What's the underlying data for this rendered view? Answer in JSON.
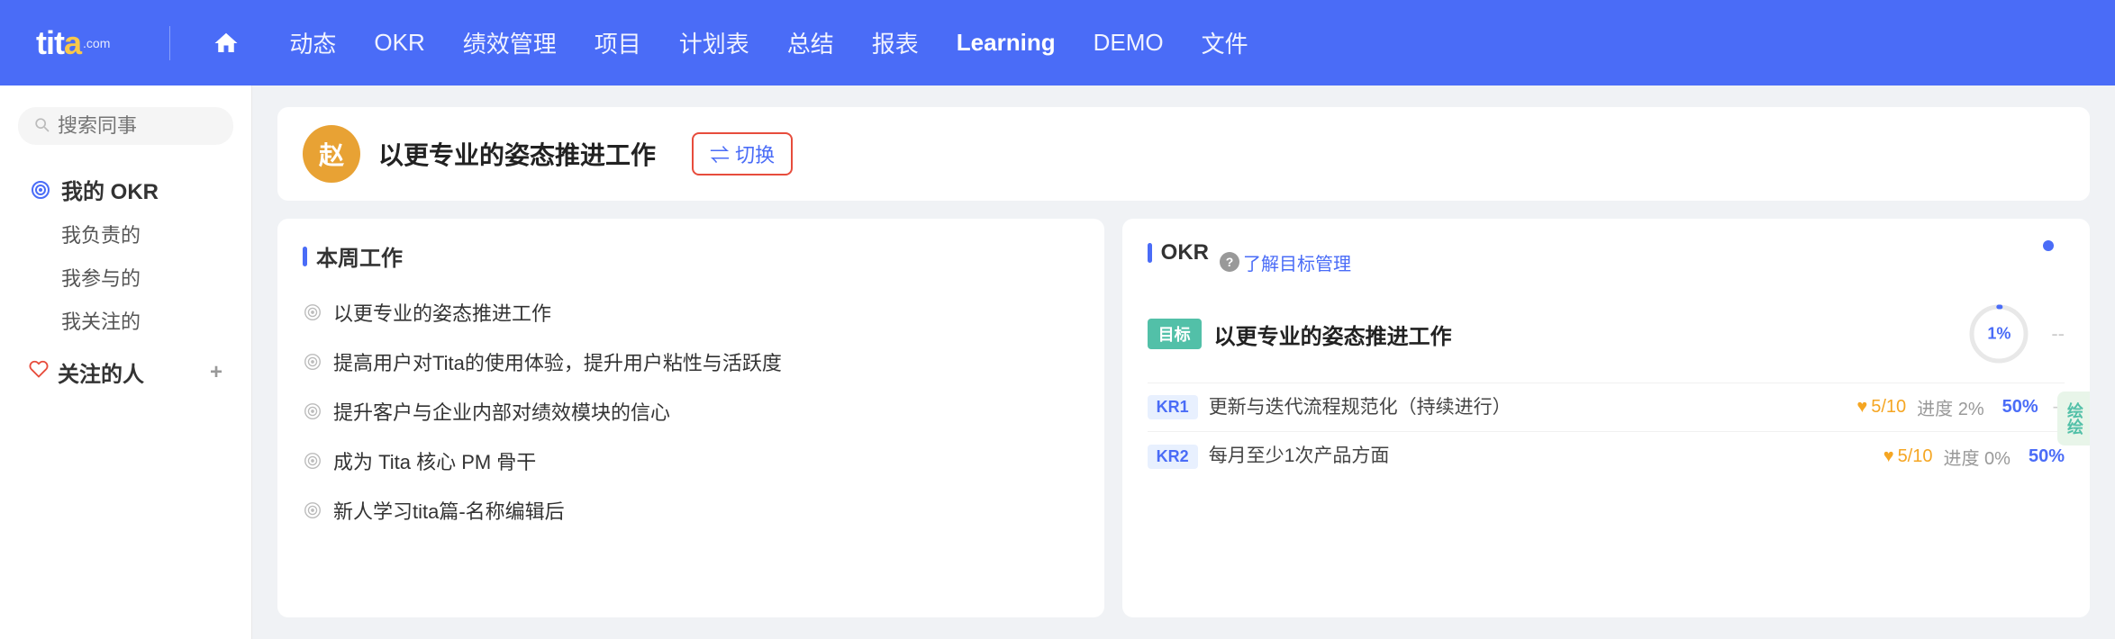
{
  "brand": {
    "name_part1": "tit",
    "name_o": "a",
    "name_com": ".com",
    "logo_display": "tita",
    "logo_suffix": ".com"
  },
  "header": {
    "nav_items": [
      {
        "label": "动态",
        "id": "dongtai"
      },
      {
        "label": "OKR",
        "id": "okr"
      },
      {
        "label": "绩效管理",
        "id": "jixiao"
      },
      {
        "label": "项目",
        "id": "xiangmu"
      },
      {
        "label": "计划表",
        "id": "jihuabiao"
      },
      {
        "label": "总结",
        "id": "zongjie"
      },
      {
        "label": "报表",
        "id": "baobiao"
      },
      {
        "label": "Learning",
        "id": "learning"
      },
      {
        "label": "DEMO",
        "id": "demo"
      },
      {
        "label": "文件",
        "id": "wenjian"
      }
    ]
  },
  "sidebar": {
    "search_placeholder": "搜索同事",
    "my_okr_label": "我的 OKR",
    "sub_items": [
      "我负责的",
      "我参与的",
      "我关注的"
    ],
    "follow_label": "关注的人",
    "plus_label": "+"
  },
  "user_section": {
    "avatar_char": "赵",
    "title": "以更专业的姿态推进工作",
    "switch_label": "⇌ 切换"
  },
  "work_section": {
    "title": "本周工作",
    "items": [
      "以更专业的姿态推进工作",
      "提高用户对Tita的使用体验，提升用户粘性与活跃度",
      "提升客户与企业内部对绩效模块的信心",
      "成为 Tita 核心 PM 骨干",
      "新人学习tita篇-名称编辑后"
    ]
  },
  "okr_section": {
    "title": "OKR",
    "help_text": "了解目标管理",
    "goal": {
      "tag": "目标",
      "text": "以更专业的姿态推进工作",
      "percent": "1%",
      "dash": "--"
    },
    "krs": [
      {
        "badge": "KR1",
        "text": "更新与迭代流程规范化（持续进行）",
        "score": "5/10",
        "progress_label": "进度 2%",
        "progress_pct": "50%",
        "dash": "--"
      },
      {
        "badge": "KR2",
        "text": "每月至少1次产品方面",
        "score": "5/10",
        "progress_label": "进度 0%",
        "progress_pct": "50%",
        "dash": ""
      }
    ],
    "edge_tab_text": "绘绘"
  },
  "colors": {
    "primary": "#4a6cf7",
    "accent_orange": "#e8a234",
    "accent_green": "#52c0a8",
    "text_main": "#333",
    "text_sub": "#999",
    "border": "#e8e8e8",
    "score_color": "#f5a623",
    "header_bg": "#4a6cf7"
  }
}
